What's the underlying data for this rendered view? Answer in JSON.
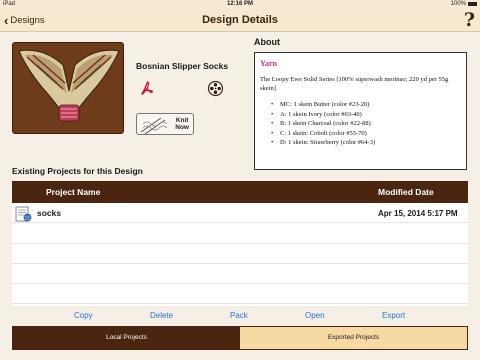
{
  "status_bar": {
    "carrier": "iPad",
    "time": "12:16 PM",
    "battery": "100%"
  },
  "nav": {
    "back_label": "Designs",
    "title": "Design Details",
    "help_label": "?"
  },
  "design": {
    "name": "Bosnian Slipper Socks",
    "knit_button": {
      "line1": "Knit",
      "line2": "Now"
    }
  },
  "about": {
    "heading": "About",
    "yarn_title": "Yarn",
    "yarn_description": "The Loopy Ewe Solid Series [100% superwash merinao; 220 yd per 55g skein]",
    "yarn_items": [
      "MC: 1 skein Butter (color #23-20)",
      "A: 1 skein Ivory (color #03-40)",
      "B: 1 skein Charcoal (color #22-88)",
      "C: 1 skein: Cobolt (color #55-70)",
      "D: 1 skein: Strawberry (color #64-3)"
    ]
  },
  "projects": {
    "heading": "Existing Projects for this Design",
    "columns": {
      "name": "Project Name",
      "date": "Modified Date"
    },
    "rows": [
      {
        "name": "socks",
        "modified": "Apr 15, 2014 5:17 PM"
      }
    ]
  },
  "actions": [
    "Copy",
    "Delete",
    "Pack",
    "Open",
    "Export"
  ],
  "segments": {
    "local": "Local Projects",
    "exported": "Exported Projects"
  },
  "colors": {
    "brown": "#4a2510",
    "link_blue": "#2a72d4",
    "yarn_pink": "#d62b8c",
    "tan": "#f6d9a3"
  },
  "icons": {
    "back": "chevron-left-icon",
    "help": "question-mark-icon",
    "pdf": "acrobat-pdf-icon",
    "film": "film-reel-icon",
    "project": "yarn-project-icon"
  }
}
